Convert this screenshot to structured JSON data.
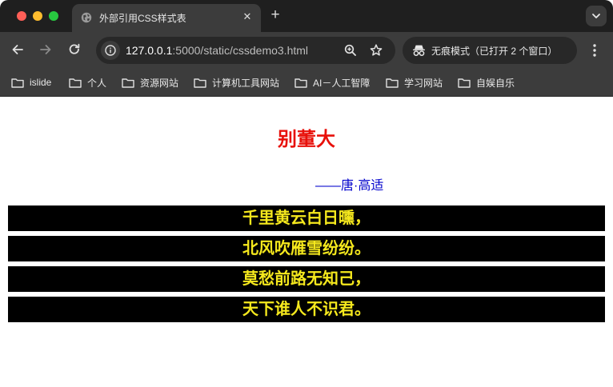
{
  "browser": {
    "tab": {
      "title": "外部引用CSS样式表",
      "close_label": "✕"
    },
    "new_tab_label": "+",
    "address": {
      "host": "127.0.0.1",
      "path": ":5000/static/cssdemo3.html"
    },
    "incognito_label": "无痕模式（已打开 2 个窗口）",
    "bookmarks": [
      {
        "label": "islide"
      },
      {
        "label": "个人"
      },
      {
        "label": "资源网站"
      },
      {
        "label": "计算机工具网站"
      },
      {
        "label": "AI－人工智障"
      },
      {
        "label": "学习网站"
      },
      {
        "label": "自娱自乐"
      }
    ]
  },
  "poem": {
    "title": "别董大",
    "author": "——唐·高适",
    "lines": [
      "千里黄云白日曛，",
      "北风吹雁雪纷纷。",
      "莫愁前路无知己，",
      "天下谁人不识君。"
    ]
  },
  "colors": {
    "title": "#e8100a",
    "author": "#0000cc",
    "line_text": "#f5e81d",
    "line_background": "#000000",
    "browser_chrome": "#3c3c3c"
  }
}
